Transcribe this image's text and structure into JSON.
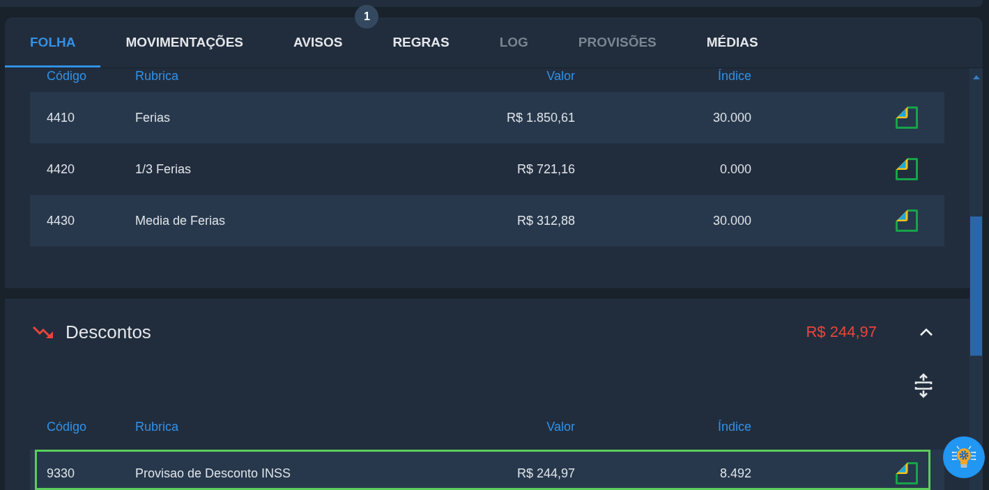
{
  "tabs": [
    {
      "label": "FOLHA",
      "selected": true,
      "disabled": false
    },
    {
      "label": "MOVIMENTAÇÕES",
      "selected": false,
      "disabled": false
    },
    {
      "label": "AVISOS",
      "selected": false,
      "disabled": false,
      "badge": "1"
    },
    {
      "label": "REGRAS",
      "selected": false,
      "disabled": false
    },
    {
      "label": "LOG",
      "selected": false,
      "disabled": true
    },
    {
      "label": "PROVISÕES",
      "selected": false,
      "disabled": true
    },
    {
      "label": "MÉDIAS",
      "selected": false,
      "disabled": false
    }
  ],
  "sections": [
    {
      "columns": [
        "Código",
        "Rubrica",
        "Valor",
        "Índice"
      ],
      "rows": [
        {
          "code": "4410",
          "rubric": "Ferias",
          "value": "R$ 1.850,61",
          "index": "30.000",
          "selected": false
        },
        {
          "code": "4420",
          "rubric": "1/3 Ferias",
          "value": "R$ 721,16",
          "index": "0.000",
          "selected": false
        },
        {
          "code": "4430",
          "rubric": "Media de Ferias",
          "value": "R$ 312,88",
          "index": "30.000",
          "selected": false
        }
      ]
    },
    {
      "title": "Descontos",
      "kind": "discount",
      "total": "R$ 244,97",
      "expanded": true,
      "columns": [
        "Código",
        "Rubrica",
        "Valor",
        "Índice"
      ],
      "rows": [
        {
          "code": "9330",
          "rubric": "Provisao de Desconto INSS",
          "value": "R$ 244,97",
          "index": "8.492",
          "selected": true
        }
      ]
    }
  ]
}
